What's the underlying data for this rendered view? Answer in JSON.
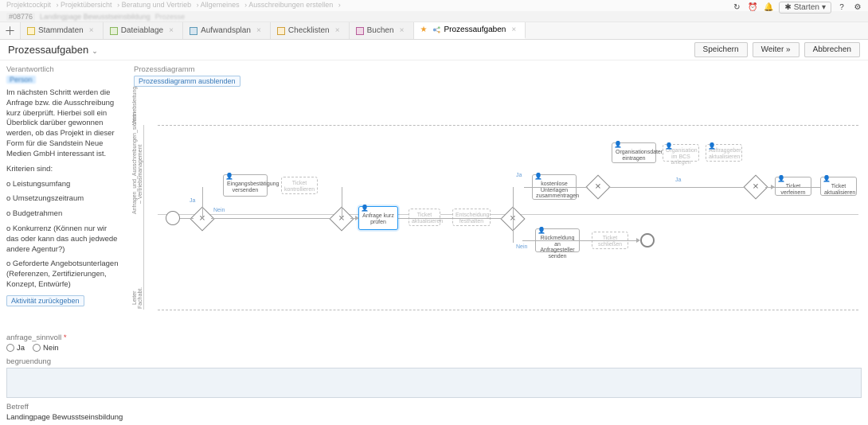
{
  "breadcrumb": [
    "Projektcockpit",
    "Projektübersicht",
    "Beratung und Vertrieb",
    "Allgemeines",
    "Ausschreibungen erstellen"
  ],
  "record": {
    "id": "#08776",
    "title": "Landingpage Bewusstseinsbildung",
    "suffix": "Prozesse"
  },
  "toolbar": {
    "refresh": "↻",
    "clock": "⏰",
    "bell": "🔔",
    "starten": "Starten",
    "chev": "▾",
    "help": "?",
    "gear": "⚙"
  },
  "tabs": [
    {
      "label": "Stammdaten"
    },
    {
      "label": "Dateiablage"
    },
    {
      "label": "Aufwandsplan"
    },
    {
      "label": "Checklisten"
    },
    {
      "label": "Buchen"
    },
    {
      "label": "Prozessaufgaben",
      "active": true,
      "star": true
    }
  ],
  "page": {
    "title": "Prozessaufgaben",
    "save": "Speichern",
    "next": "Weiter »",
    "cancel": "Abbrechen"
  },
  "sidebar": {
    "resp_label": "Verantwortlich",
    "resp_person": "Person",
    "desc1": "Im nächsten Schritt werden die Anfrage bzw. die Ausschreibung kurz überprüft. Hierbei soll ein Überblick darüber gewonnen werden, ob das Projekt in dieser Form für die Sandstein Neue Medien GmbH interessant ist.",
    "criteria_head": "Kriterien sind:",
    "c1": "o Leistungsumfang",
    "c2": "o Umsetzungszeitraum",
    "c3": "o Budgetrahmen",
    "c4": "o Konkurrenz (Können nur wir das oder kann das auch jedwede andere Agentur?)",
    "c5": "o Geforderte Angebotsunterlagen (Referenzen, Zertifizierungen, Konzept, Entwürfe)",
    "activity_back": "Aktivität zurückgeben"
  },
  "diagram": {
    "title": "Prozessdiagramm",
    "toggle": "Prozessdiagramm ausblenden",
    "lane1": "Vertriebsleitung",
    "lane2": "Anfragen_und_Ausschreibungen_sichten – Vertriebsmanagement",
    "lane3": "Leiter Fachabt.",
    "nodes": {
      "n1": "Eingangsbestätigung versenden",
      "n2": "Ticket kontrollieren",
      "n3": "Anfrage kurz prüfen",
      "n4": "Ticket aktualisieren",
      "n5": "Entscheidung festhalten",
      "n6": "kostenlose Unterlagen zusammentragen",
      "n7": "Organisationsdaten eintragen",
      "n8": "Organisation im BCS anlegen",
      "n9": "Auftraggeber aktualisieren",
      "n10": "Ticket verfeinern",
      "n11": "Ticket aktualisieren",
      "n12": "Rückmeldung an Anfragesteller senden",
      "n13": "Ticket schließen"
    },
    "edges": {
      "ja": "Ja",
      "nein": "Nein"
    }
  },
  "form": {
    "q1_label": "anfrage_sinnvoll",
    "q1_yes": "Ja",
    "q1_no": "Nein",
    "reason_label": "begruendung",
    "subject_label": "Betreff",
    "subject_value": "Landingpage Bewusstseinsbildung"
  }
}
